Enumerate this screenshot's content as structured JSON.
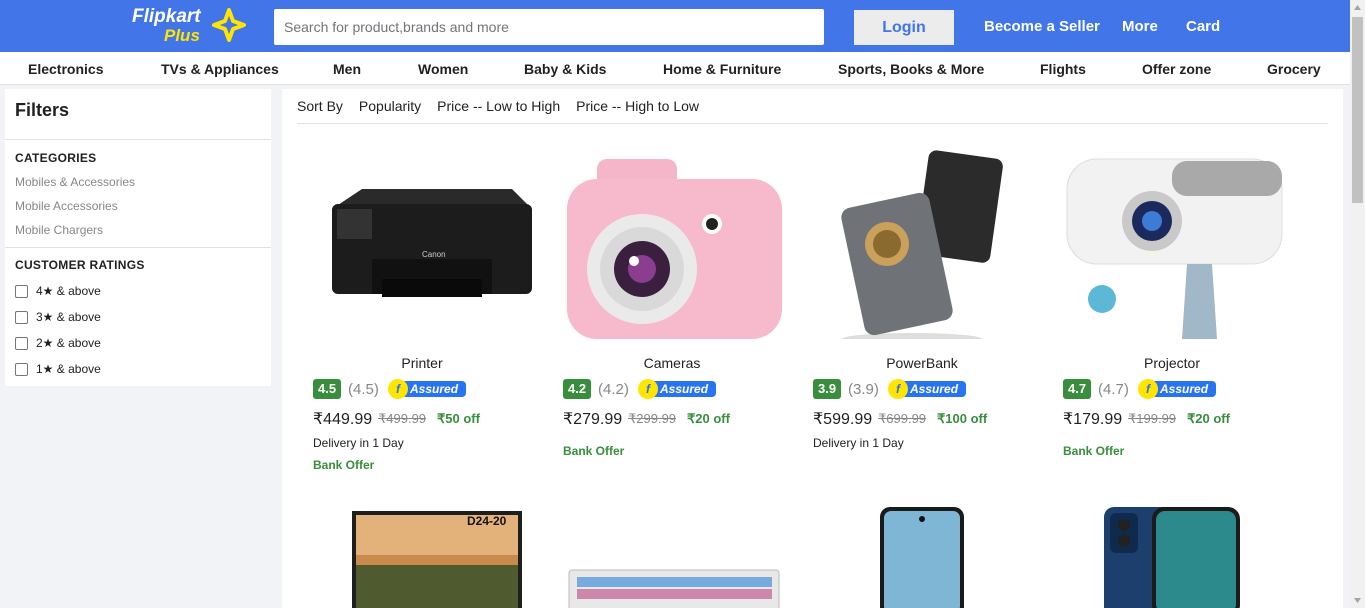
{
  "header": {
    "logo_text": "Flipkart",
    "logo_sub": "Plus",
    "search_placeholder": "Search for product,brands and more",
    "login_label": "Login",
    "links": [
      "Become a Seller",
      "More",
      "Card"
    ]
  },
  "categories_nav": [
    "Electronics",
    "TVs & Appliances",
    "Men",
    "Women",
    "Baby & Kids",
    "Home & Furniture",
    "Sports, Books & More",
    "Flights",
    "Offer zone",
    "Grocery"
  ],
  "filters": {
    "title": "Filters",
    "categories_heading": "CATEGORIES",
    "categories": [
      "Mobiles & Accessories",
      "Mobile Accessories",
      "Mobile Chargers"
    ],
    "ratings_heading": "CUSTOMER RATINGS",
    "ratings": [
      "4★ & above",
      "3★ & above",
      "2★ & above",
      "1★ & above"
    ]
  },
  "sort": {
    "label": "Sort By",
    "options": [
      "Popularity",
      "Price -- Low to High",
      "Price -- High to Low"
    ]
  },
  "assured_label": "Assured",
  "products": [
    {
      "name": "Printer",
      "rating": "4.5",
      "rating_paren": "(4.5)",
      "price": "₹449.99",
      "mrp": "₹499.99",
      "off": "₹50 off",
      "delivery_prefix": "Delivery in ",
      "delivery_days": "1 Day",
      "bank_offer": "Bank Offer",
      "image_icon": "printer-image"
    },
    {
      "name": "Cameras",
      "rating": "4.2",
      "rating_paren": "(4.2)",
      "price": "₹279.99",
      "mrp": "₹299.99",
      "off": "₹20 off",
      "delivery_prefix": "",
      "delivery_days": "",
      "bank_offer": "Bank Offer",
      "image_icon": "camera-image"
    },
    {
      "name": "PowerBank",
      "rating": "3.9",
      "rating_paren": "(3.9)",
      "price": "₹599.99",
      "mrp": "₹699.99",
      "off": "₹100 off",
      "delivery_prefix": "Delivery in ",
      "delivery_days": "1 Day",
      "bank_offer": "",
      "image_icon": "powerbank-image"
    },
    {
      "name": "Projector",
      "rating": "4.7",
      "rating_paren": "(4.7)",
      "price": "₹179.99",
      "mrp": "₹199.99",
      "off": "₹20 off",
      "delivery_prefix": "",
      "delivery_days": "",
      "bank_offer": "Bank Offer",
      "image_icon": "projector-image"
    }
  ],
  "second_row": {
    "monitor_label": "D24-20"
  },
  "colors": {
    "header_blue": "#4275e8",
    "rating_green": "#388e3c",
    "logo_yellow": "#ffe500"
  }
}
